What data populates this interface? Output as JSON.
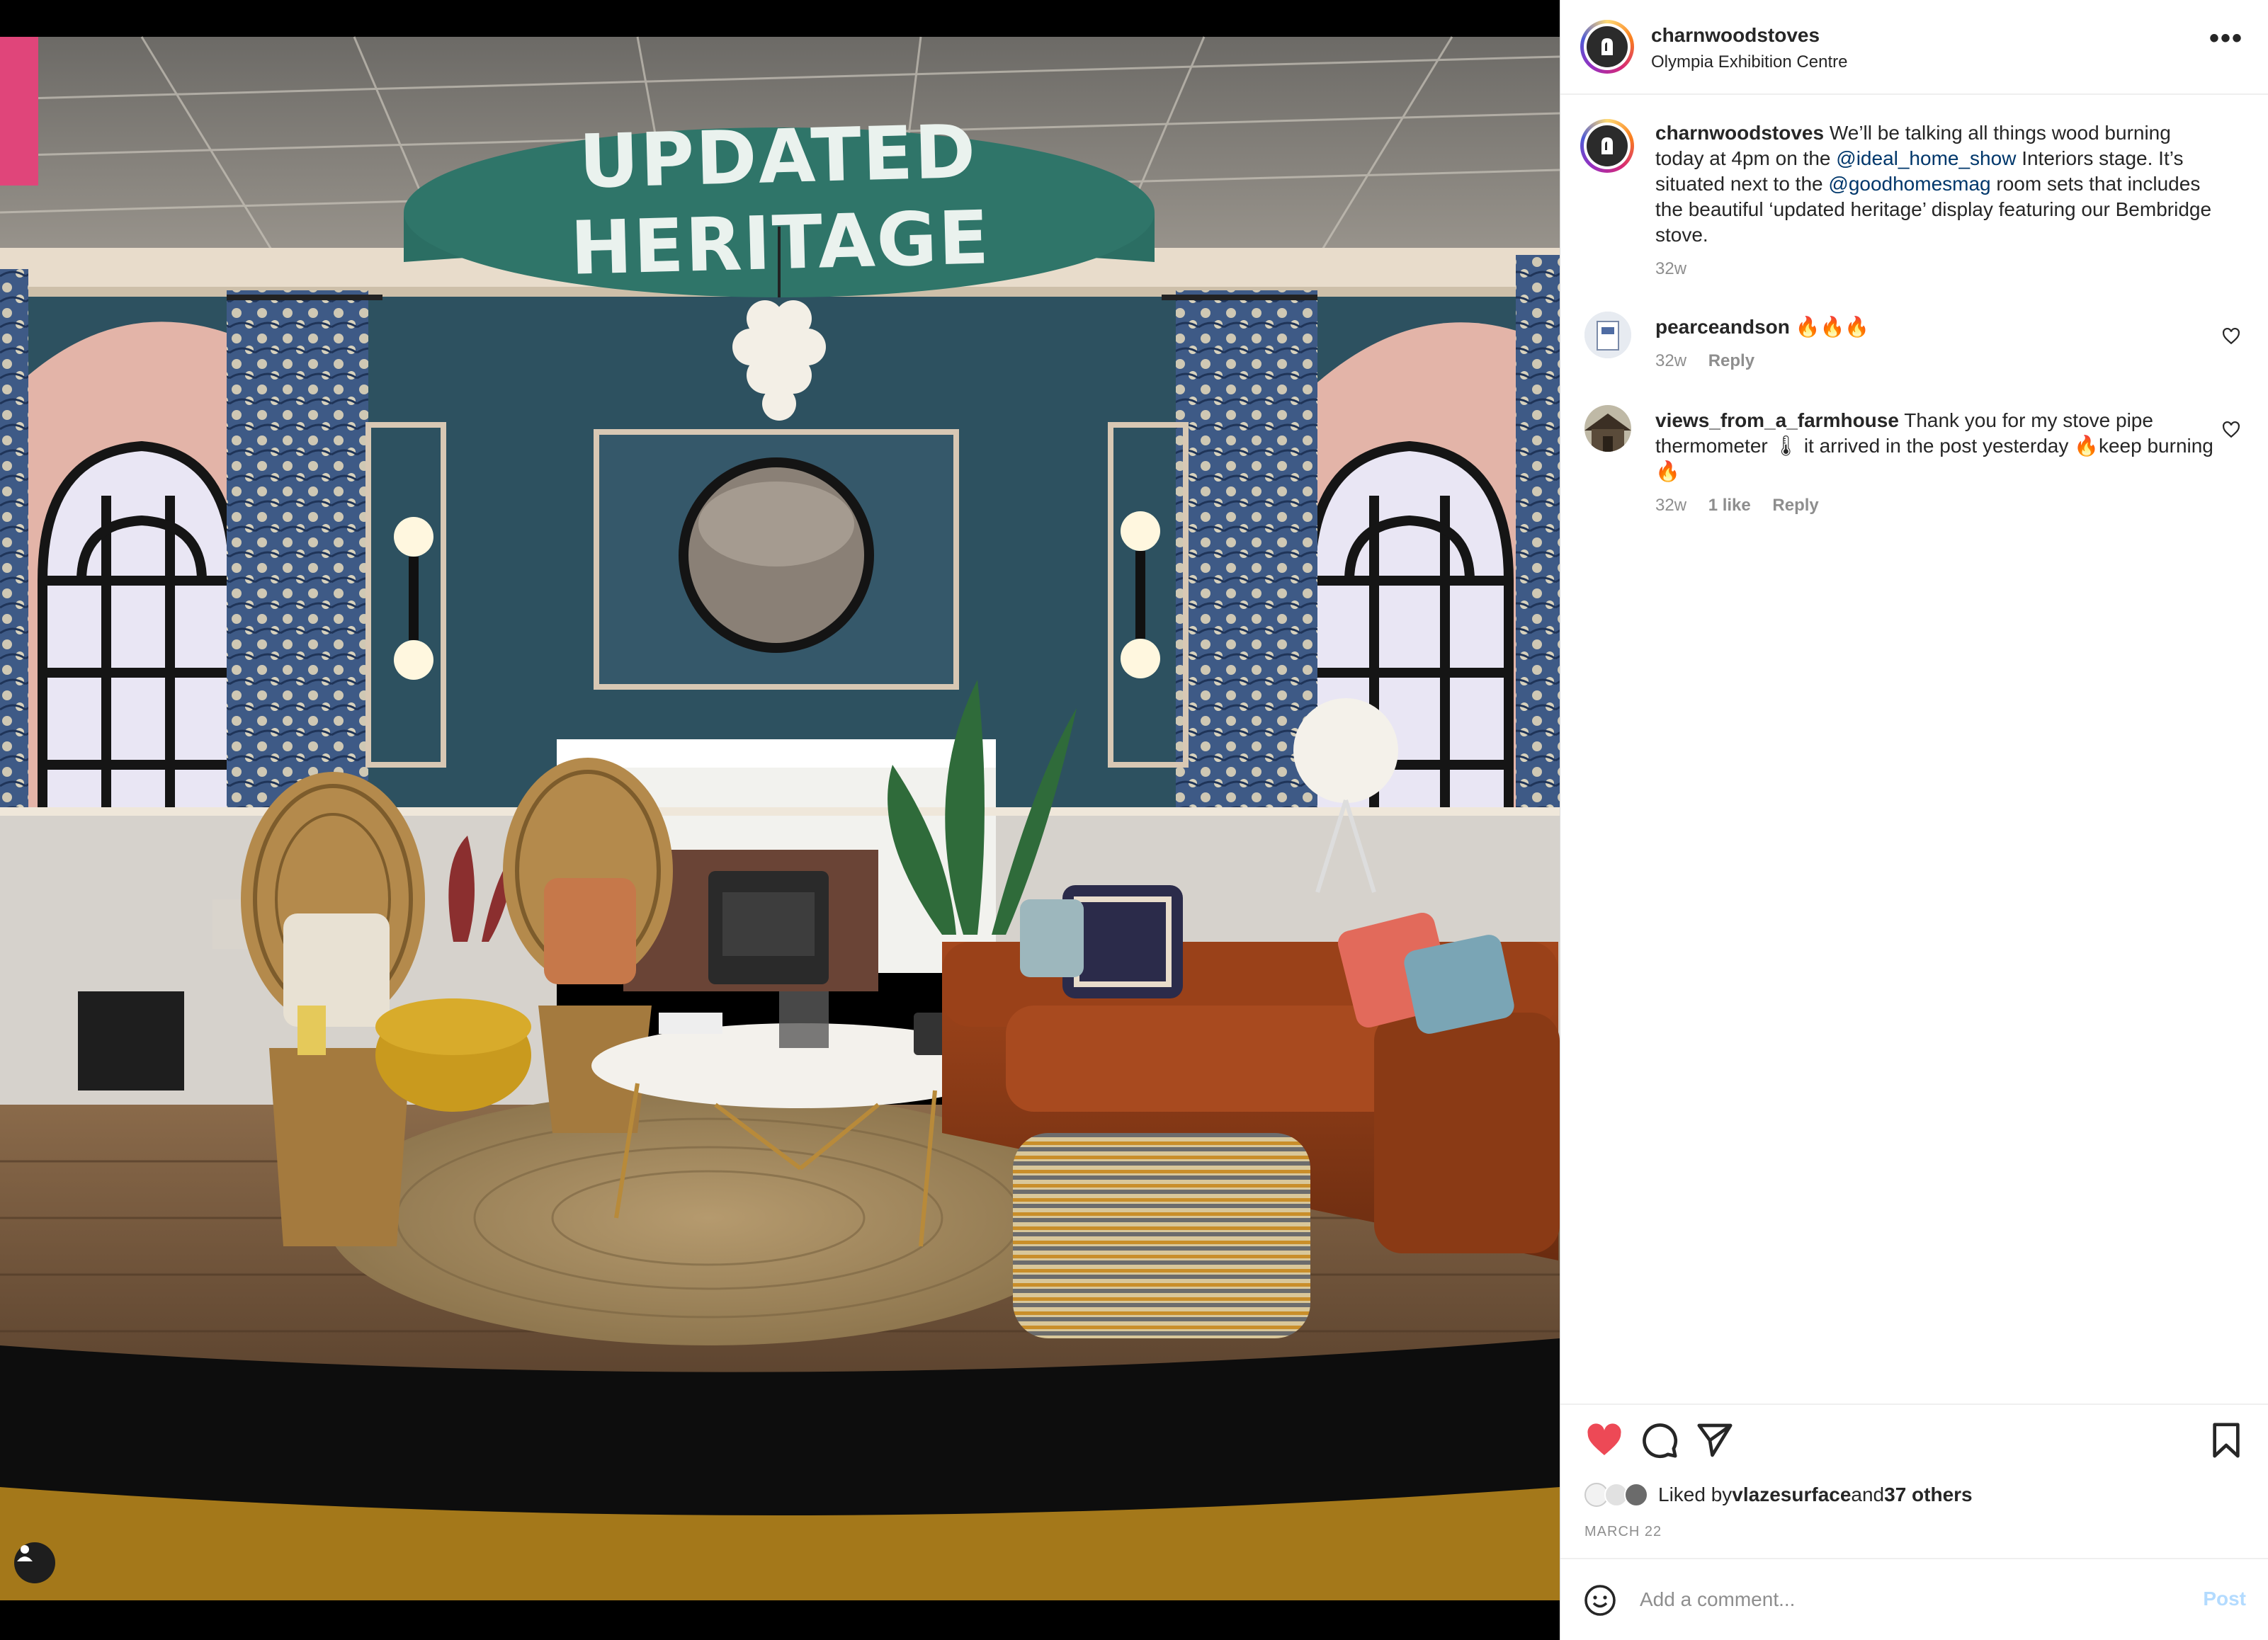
{
  "photo": {
    "sign_text": "UPDATED HERITAGE",
    "tag_icon": "user-tag-icon"
  },
  "post": {
    "author": "charnwoodstoves",
    "location": "Olympia Exhibition Centre",
    "more_icon": "more-options-icon",
    "caption": {
      "username": "charnwoodstoves",
      "text_1": " We’ll be talking all things wood burning today at 4pm on the ",
      "mention_1": "@ideal_home_show",
      "text_2": " Interiors stage. It’s situated next to the ",
      "mention_2": "@goodhomesmag",
      "text_3": " room sets that includes the beautiful ‘updated heritage’ display featuring our Bembridge stove.",
      "time": "32w"
    },
    "comments": [
      {
        "username": "pearceandson",
        "text": " 🔥🔥🔥",
        "time": "32w",
        "likes": "",
        "reply": "Reply"
      },
      {
        "username": "views_from_a_farmhouse",
        "text": " Thank you for my stove pipe thermometer 🌡 it arrived in the post yesterday 🔥keep burning 🔥",
        "time": "32w",
        "likes": "1 like",
        "reply": "Reply"
      }
    ],
    "actions": {
      "liked": true,
      "like_color": "#ed4956",
      "icons": [
        "heart-icon",
        "comment-icon",
        "share-icon",
        "bookmark-icon"
      ]
    },
    "likes": {
      "prefix": "Liked by ",
      "user": "vlazesurface",
      "middle": " and ",
      "others": "37 others"
    },
    "date": "MARCH 22",
    "add_comment": {
      "placeholder": "Add a comment...",
      "post_label": "Post",
      "emoji_icon": "emoji-icon"
    }
  }
}
